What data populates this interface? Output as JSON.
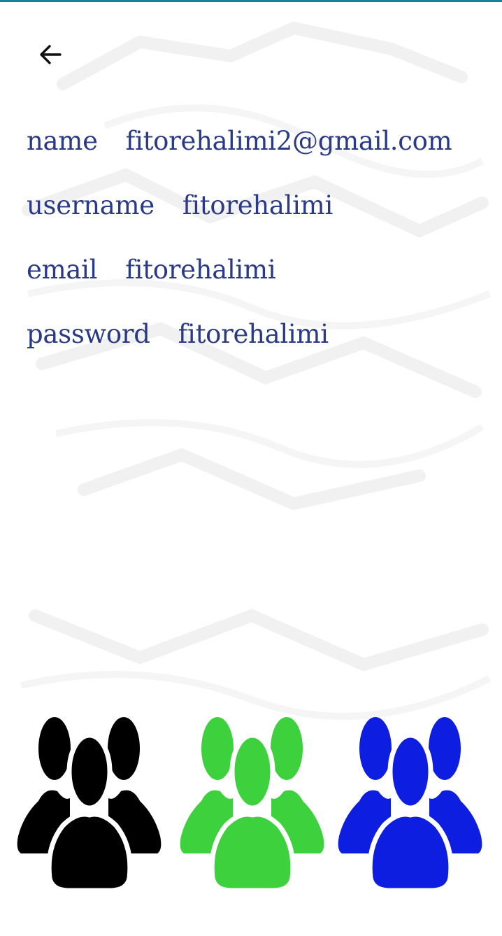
{
  "header": {
    "back_icon": "arrow-left-icon"
  },
  "profile": [
    {
      "label": "name",
      "value": "fitorehalimi2@gmail.com"
    },
    {
      "label": "username",
      "value": "fitorehalimi"
    },
    {
      "label": "email",
      "value": "fitorehalimi"
    },
    {
      "label": "password",
      "value": "fitorehalimi"
    }
  ],
  "group_icons": [
    {
      "icon": "users-group-icon",
      "color": "#000000"
    },
    {
      "icon": "users-group-icon",
      "color": "#3dd13d"
    },
    {
      "icon": "users-group-icon",
      "color": "#0e1ee0"
    }
  ],
  "theme": {
    "text_color": "#2a3a86",
    "status_bar_color": "#1f7f99"
  }
}
